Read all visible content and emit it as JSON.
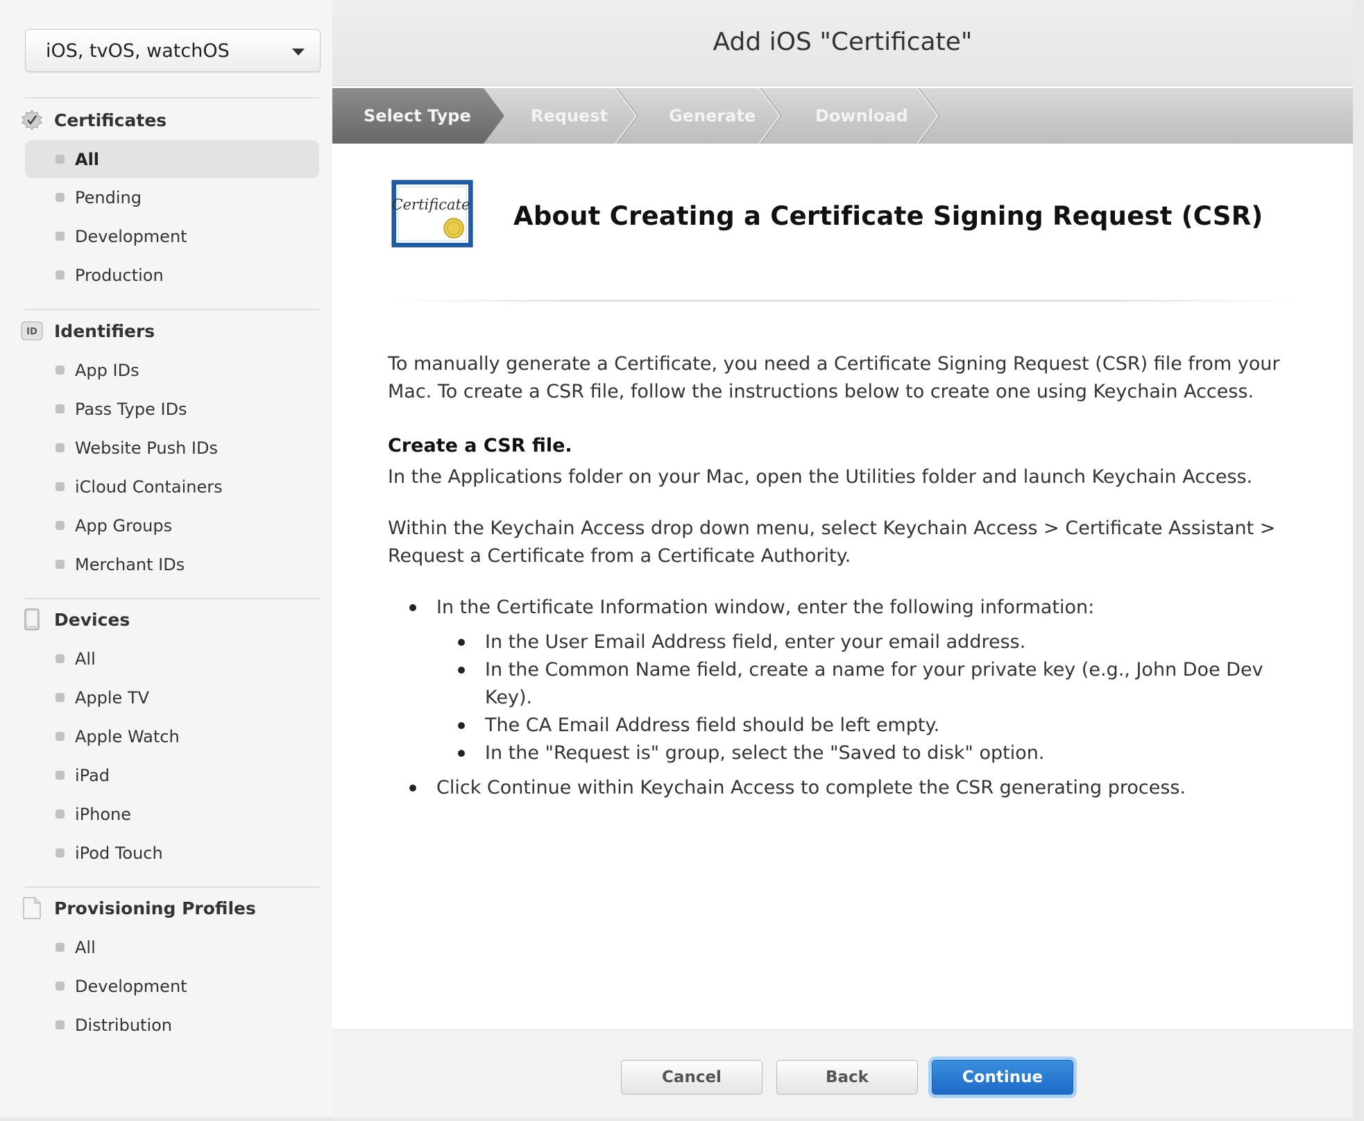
{
  "sidebar": {
    "platform_select": "iOS, tvOS, watchOS",
    "sections": [
      {
        "title": "Certificates",
        "icon": "certificate-badge-icon",
        "items": [
          "All",
          "Pending",
          "Development",
          "Production"
        ],
        "active": 0
      },
      {
        "title": "Identifiers",
        "icon": "id-icon",
        "items": [
          "App IDs",
          "Pass Type IDs",
          "Website Push IDs",
          "iCloud Containers",
          "App Groups",
          "Merchant IDs"
        ]
      },
      {
        "title": "Devices",
        "icon": "device-icon",
        "items": [
          "All",
          "Apple TV",
          "Apple Watch",
          "iPad",
          "iPhone",
          "iPod Touch"
        ]
      },
      {
        "title": "Provisioning Profiles",
        "icon": "document-icon",
        "items": [
          "All",
          "Development",
          "Distribution"
        ]
      }
    ],
    "id_icon_text": "ID"
  },
  "header": {
    "title": "Add iOS \"Certificate\""
  },
  "steps": [
    "Select Type",
    "Request",
    "Generate",
    "Download"
  ],
  "active_step": 0,
  "content": {
    "cert_icon_text": "Certificate",
    "title": "About Creating a Certificate Signing Request (CSR)",
    "intro_line1": "To manually generate a Certificate, you need a Certificate Signing Request (CSR) file from your",
    "intro_line2": "Mac. To create a CSR file, follow the instructions below to create one using Keychain Access.",
    "create_heading": "Create a CSR file.",
    "create_text": "In the Applications folder on your Mac, open the Utilities folder and launch Keychain Access.",
    "menu_line1": "Within the Keychain Access drop down menu, select Keychain Access > Certificate Assistant >",
    "menu_line2": "Request a Certificate from a Certificate Authority.",
    "bullet1": "In the Certificate Information window, enter the following information:",
    "sub1": "In the User Email Address field, enter your email address.",
    "sub2_line1": "In the Common Name field, create a name for your private key (e.g., John Doe Dev",
    "sub2_line2": "Key).",
    "sub3": "The CA Email Address field should be left empty.",
    "sub4": "In the \"Request is\" group, select the \"Saved to disk\" option.",
    "bullet2": "Click Continue within Keychain Access to complete the CSR generating process."
  },
  "footer": {
    "cancel": "Cancel",
    "back": "Back",
    "continue": "Continue"
  },
  "colors": {
    "primary": "#1c6ac6",
    "focus_ring": "#a9d0f7",
    "active_step": "#7a7a7a"
  }
}
